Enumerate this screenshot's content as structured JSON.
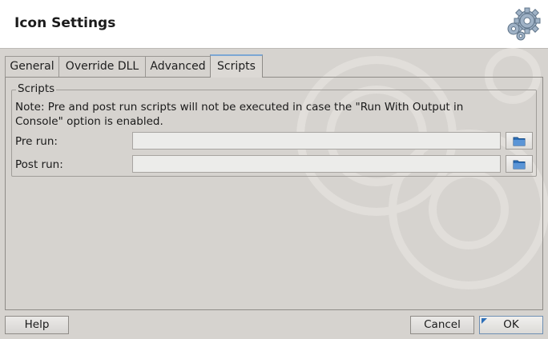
{
  "window": {
    "title": "Icon Settings"
  },
  "tabs": [
    {
      "label": "General"
    },
    {
      "label": "Override DLL"
    },
    {
      "label": "Advanced"
    },
    {
      "label": "Scripts",
      "active": true
    }
  ],
  "scripts": {
    "group_title": "Scripts",
    "note": "Note: Pre and post run scripts will not be executed in case the \"Run With Output in Console\" option is enabled.",
    "pre_run": {
      "label": "Pre run:",
      "value": ""
    },
    "post_run": {
      "label": "Post run:",
      "value": ""
    }
  },
  "buttons": {
    "help": "Help",
    "cancel": "Cancel",
    "ok": "OK"
  },
  "colors": {
    "accent": "#7ba7d4",
    "folder_icon": "#2d6fb8",
    "background": "#d6d3cf"
  },
  "icons": {
    "header": "gears-icon",
    "browse": "folder-icon"
  }
}
